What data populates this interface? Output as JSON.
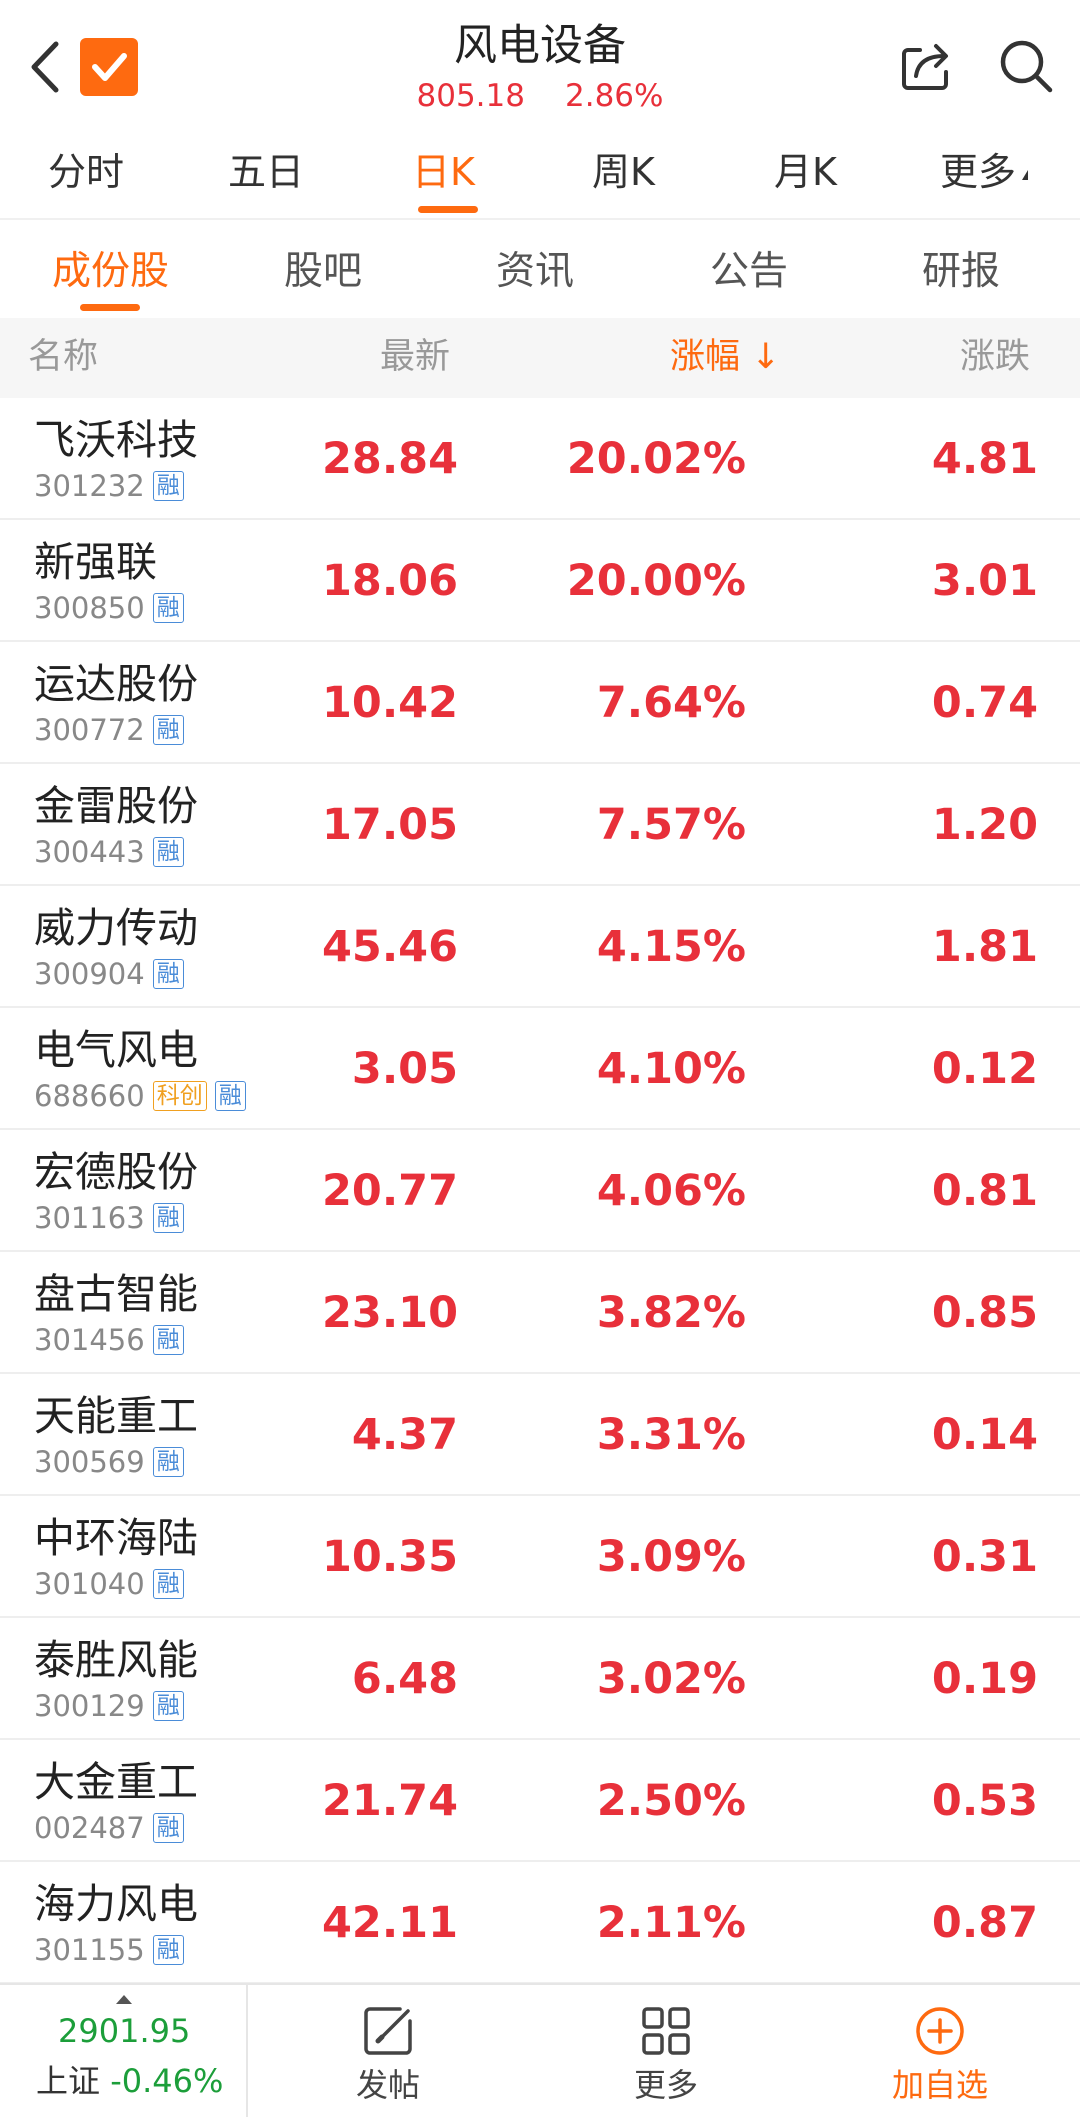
{
  "header": {
    "title": "风电设备",
    "index_value": "805.18",
    "index_change": "2.86%"
  },
  "period_tabs": [
    {
      "label": "分时"
    },
    {
      "label": "五日"
    },
    {
      "label": "日K"
    },
    {
      "label": "周K"
    },
    {
      "label": "月K"
    },
    {
      "label": "更多"
    }
  ],
  "period_active": "日K",
  "content_tabs": [
    {
      "label": "成份股"
    },
    {
      "label": "股吧"
    },
    {
      "label": "资讯"
    },
    {
      "label": "公告"
    },
    {
      "label": "研报"
    }
  ],
  "content_active": "成份股",
  "columns": {
    "name": "名称",
    "latest": "最新",
    "pct": "涨幅",
    "pct_sort_arrow": "↓",
    "change": "涨跌"
  },
  "rows": [
    {
      "name": "飞沃科技",
      "code": "301232",
      "badges": [
        "融"
      ],
      "latest": "28.84",
      "pct": "20.02%",
      "change": "4.81"
    },
    {
      "name": "新强联",
      "code": "300850",
      "badges": [
        "融"
      ],
      "latest": "18.06",
      "pct": "20.00%",
      "change": "3.01"
    },
    {
      "name": "运达股份",
      "code": "300772",
      "badges": [
        "融"
      ],
      "latest": "10.42",
      "pct": "7.64%",
      "change": "0.74"
    },
    {
      "name": "金雷股份",
      "code": "300443",
      "badges": [
        "融"
      ],
      "latest": "17.05",
      "pct": "7.57%",
      "change": "1.20"
    },
    {
      "name": "威力传动",
      "code": "300904",
      "badges": [
        "融"
      ],
      "latest": "45.46",
      "pct": "4.15%",
      "change": "1.81"
    },
    {
      "name": "电气风电",
      "code": "688660",
      "badges": [
        "科创",
        "融"
      ],
      "latest": "3.05",
      "pct": "4.10%",
      "change": "0.12"
    },
    {
      "name": "宏德股份",
      "code": "301163",
      "badges": [
        "融"
      ],
      "latest": "20.77",
      "pct": "4.06%",
      "change": "0.81"
    },
    {
      "name": "盘古智能",
      "code": "301456",
      "badges": [
        "融"
      ],
      "latest": "23.10",
      "pct": "3.82%",
      "change": "0.85"
    },
    {
      "name": "天能重工",
      "code": "300569",
      "badges": [
        "融"
      ],
      "latest": "4.37",
      "pct": "3.31%",
      "change": "0.14"
    },
    {
      "name": "中环海陆",
      "code": "301040",
      "badges": [
        "融"
      ],
      "latest": "10.35",
      "pct": "3.09%",
      "change": "0.31"
    },
    {
      "name": "泰胜风能",
      "code": "300129",
      "badges": [
        "融"
      ],
      "latest": "6.48",
      "pct": "3.02%",
      "change": "0.19"
    },
    {
      "name": "大金重工",
      "code": "002487",
      "badges": [
        "融"
      ],
      "latest": "21.74",
      "pct": "2.50%",
      "change": "0.53"
    },
    {
      "name": "海力风电",
      "code": "301155",
      "badges": [
        "融"
      ],
      "latest": "42.11",
      "pct": "2.11%",
      "change": "0.87"
    }
  ],
  "bottom_bar": {
    "index_value": "2901.95",
    "index_name": "上证",
    "index_change": "-0.46%",
    "post_label": "发帖",
    "more_label": "更多",
    "add_label": "加自选"
  },
  "colors": {
    "accent": "#fe6a10",
    "up": "#e8303a",
    "down": "#1c9e3a"
  },
  "icons": [
    "back-arrow-icon",
    "checkbox-icon",
    "share-icon",
    "search-icon",
    "edit-icon",
    "grid-icon",
    "plus-circle-icon"
  ]
}
